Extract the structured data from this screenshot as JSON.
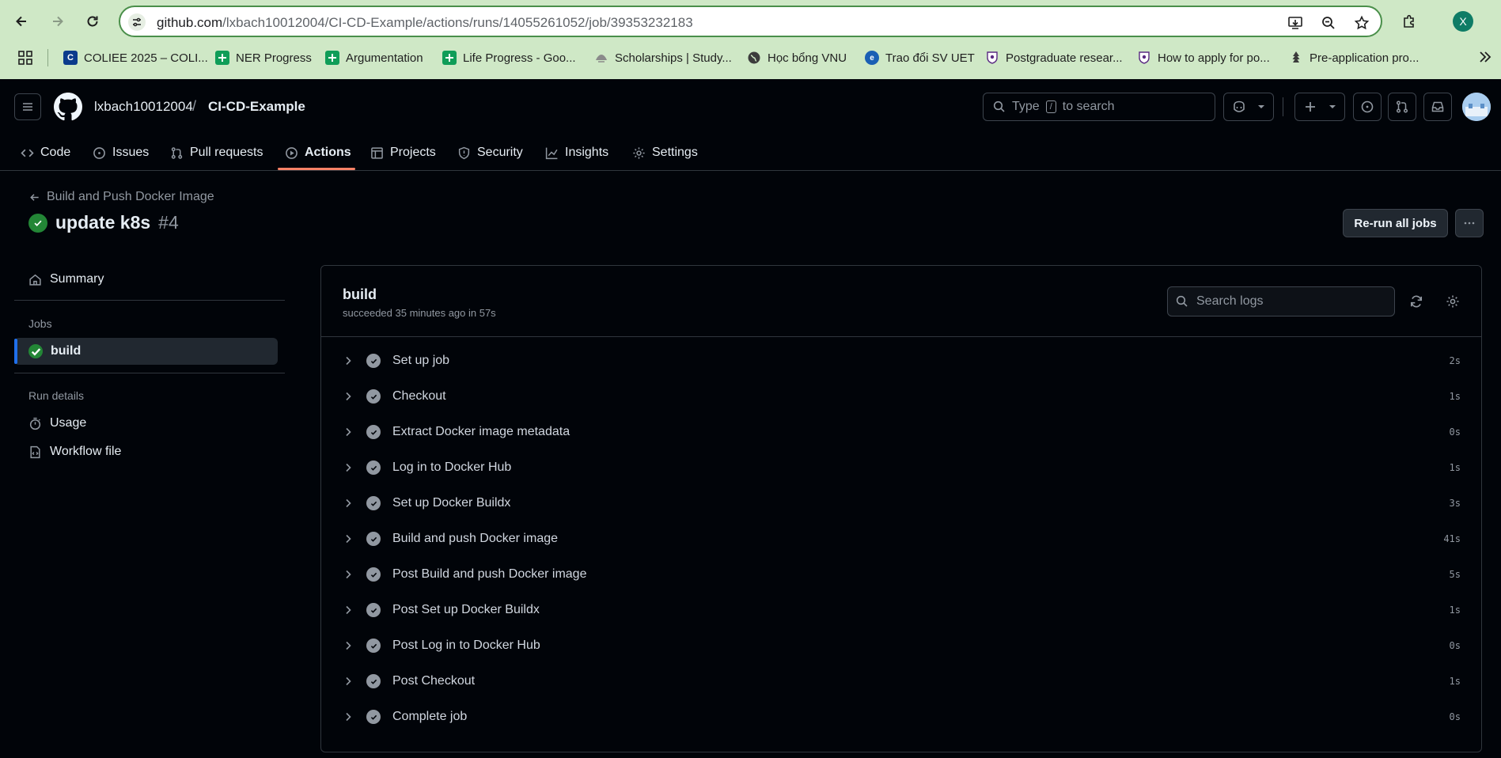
{
  "browser": {
    "url_host": "github.com",
    "url_path": "/lxbach10012004/CI-CD-Example/actions/runs/14055261052/job/39353232183",
    "profile_initial": "X",
    "bookmarks": [
      {
        "label": "COLIEE 2025 – COLI...",
        "icon": "coliee-icon",
        "color": "#0b3b8c"
      },
      {
        "label": "NER Progress",
        "icon": "sheets-icon",
        "color": "#0f9d58"
      },
      {
        "label": "Argumentation",
        "icon": "sheets-icon",
        "color": "#0f9d58"
      },
      {
        "label": "Life Progress - Goo...",
        "icon": "sheets-icon",
        "color": "#0f9d58"
      },
      {
        "label": "Scholarships | Study...",
        "icon": "gov-icon",
        "color": "#6b6b6b"
      },
      {
        "label": "Học bổng VNU",
        "icon": "globe-icon",
        "color": "#3c3c3c"
      },
      {
        "label": "Trao đổi SV UET",
        "icon": "uet-icon",
        "color": "#1a5fb4"
      },
      {
        "label": "Postgraduate resear...",
        "icon": "crest-icon",
        "color": "#5a2a82"
      },
      {
        "label": "How to apply for po...",
        "icon": "crest-icon",
        "color": "#5a2a82"
      },
      {
        "label": "Pre-application pro...",
        "icon": "tree-icon",
        "color": "#3b3b3b"
      }
    ]
  },
  "github": {
    "owner": "lxbach10012004",
    "slash": "/",
    "repo": "CI-CD-Example",
    "search_prefix": "Type",
    "search_key": "/",
    "search_suffix": "to search",
    "tabs": [
      {
        "label": "Code",
        "icon": "code-icon"
      },
      {
        "label": "Issues",
        "icon": "issue-icon"
      },
      {
        "label": "Pull requests",
        "icon": "pull-request-icon"
      },
      {
        "label": "Actions",
        "icon": "play-icon",
        "active": true
      },
      {
        "label": "Projects",
        "icon": "table-icon"
      },
      {
        "label": "Security",
        "icon": "shield-icon"
      },
      {
        "label": "Insights",
        "icon": "graph-icon"
      },
      {
        "label": "Settings",
        "icon": "gear-icon"
      }
    ]
  },
  "run": {
    "back_label": "Build and Push Docker Image",
    "title": "update k8s",
    "number": "#4",
    "rerun_label": "Re-run all jobs"
  },
  "sidebar": {
    "summary": "Summary",
    "jobs_heading": "Jobs",
    "job": "build",
    "run_details_heading": "Run details",
    "usage": "Usage",
    "workflow_file": "Workflow file"
  },
  "job": {
    "name": "build",
    "status": "succeeded 35 minutes ago in 57s",
    "search_placeholder": "Search logs",
    "steps": [
      {
        "name": "Set up job",
        "duration": "2s"
      },
      {
        "name": "Checkout",
        "duration": "1s"
      },
      {
        "name": "Extract Docker image metadata",
        "duration": "0s"
      },
      {
        "name": "Log in to Docker Hub",
        "duration": "1s"
      },
      {
        "name": "Set up Docker Buildx",
        "duration": "3s"
      },
      {
        "name": "Build and push Docker image",
        "duration": "41s"
      },
      {
        "name": "Post Build and push Docker image",
        "duration": "5s"
      },
      {
        "name": "Post Set up Docker Buildx",
        "duration": "1s"
      },
      {
        "name": "Post Log in to Docker Hub",
        "duration": "0s"
      },
      {
        "name": "Post Checkout",
        "duration": "1s"
      },
      {
        "name": "Complete job",
        "duration": "0s"
      }
    ]
  },
  "colors": {
    "success": "#238636",
    "accent_underline": "#f78166",
    "active_bar": "#1f6feb"
  }
}
